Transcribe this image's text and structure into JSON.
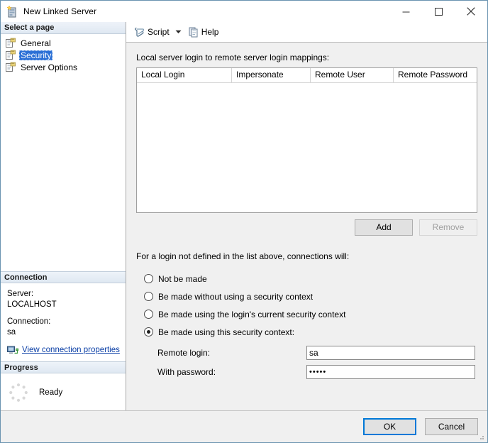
{
  "window": {
    "title": "New Linked Server",
    "icon": "linked-server-icon",
    "controls": {
      "minimize": "—",
      "maximize": "□",
      "close": "✕"
    }
  },
  "sidebar": {
    "select_page_header": "Select a page",
    "pages": [
      {
        "label": "General",
        "selected": false
      },
      {
        "label": "Security",
        "selected": true
      },
      {
        "label": "Server Options",
        "selected": false
      }
    ],
    "connection": {
      "header": "Connection",
      "server_label": "Server:",
      "server_value": "LOCALHOST",
      "connection_label": "Connection:",
      "connection_value": "sa",
      "view_properties_link": "View connection properties"
    },
    "progress": {
      "header": "Progress",
      "status": "Ready"
    }
  },
  "toolbar": {
    "script_label": "Script",
    "script_icon": "script-icon",
    "caret": "▾",
    "help_label": "Help",
    "help_icon": "help-icon"
  },
  "main": {
    "mappings_label": "Local server login to remote server login mappings:",
    "columns": [
      "Local Login",
      "Impersonate",
      "Remote User",
      "Remote Password"
    ],
    "rows": [],
    "add_label": "Add",
    "remove_label": "Remove",
    "remove_disabled": true,
    "fallback_label": "For a login not defined in the list above, connections will:",
    "options": [
      {
        "label": "Not be made",
        "selected": false
      },
      {
        "label": "Be made without using a security context",
        "selected": false
      },
      {
        "label": "Be made using the login's current security context",
        "selected": false
      },
      {
        "label": "Be made using this security context:",
        "selected": true
      }
    ],
    "remote_login_label": "Remote login:",
    "remote_login_value": "sa",
    "password_label": "With password:",
    "password_value": "•••••"
  },
  "footer": {
    "ok_label": "OK",
    "cancel_label": "Cancel"
  },
  "colors": {
    "accent": "#0078d7",
    "selection": "#2a6fd6",
    "link": "#0b3fa6",
    "window_border": "#6a93b0",
    "pane_header_top": "#eef3f9",
    "pane_header_bottom": "#dfe8f2"
  }
}
